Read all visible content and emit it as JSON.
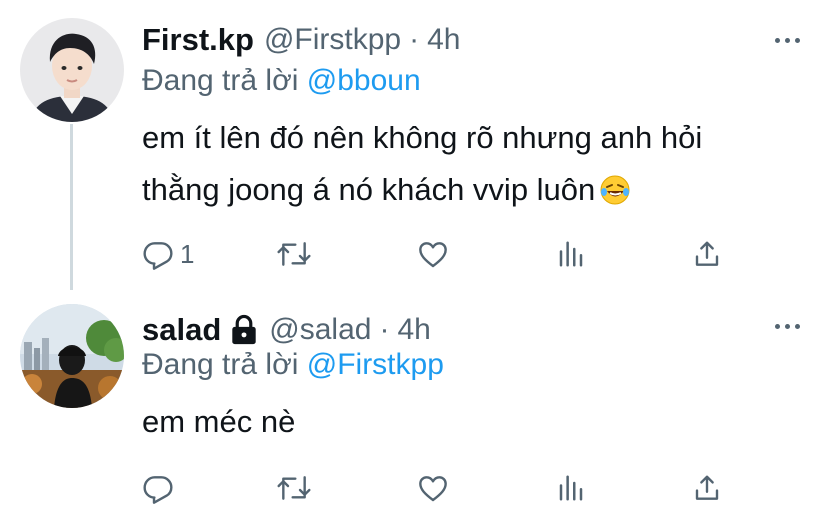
{
  "tweets": [
    {
      "display_name": "First.kp",
      "handle": "@Firstkpp",
      "separator": "·",
      "time": "4h",
      "replying_prefix": "Đang trả lời",
      "replying_to": "@bboun",
      "text_line1": "em ít lên đó nên không rõ nhưng anh hỏi",
      "text_line2": "thằng joong á nó khách vvip luôn",
      "emoji_icon": "rolling-on-floor-laughing-emoji",
      "reply_count": "1",
      "protected": false
    },
    {
      "display_name": "salad",
      "handle": "@salad",
      "separator": "·",
      "time": "4h",
      "replying_prefix": "Đang trả lời",
      "replying_to": "@Firstkpp",
      "text_line1": "em méc nè",
      "reply_count": "",
      "protected": true
    }
  ],
  "icons": [
    "more-icon",
    "reply-icon",
    "retweet-icon",
    "like-icon",
    "stats-icon",
    "share-icon",
    "lock-icon"
  ],
  "colors": {
    "text": "#0f1419",
    "secondary": "#536471",
    "link": "#1d9bf0",
    "thread_line": "#cfd9de"
  }
}
